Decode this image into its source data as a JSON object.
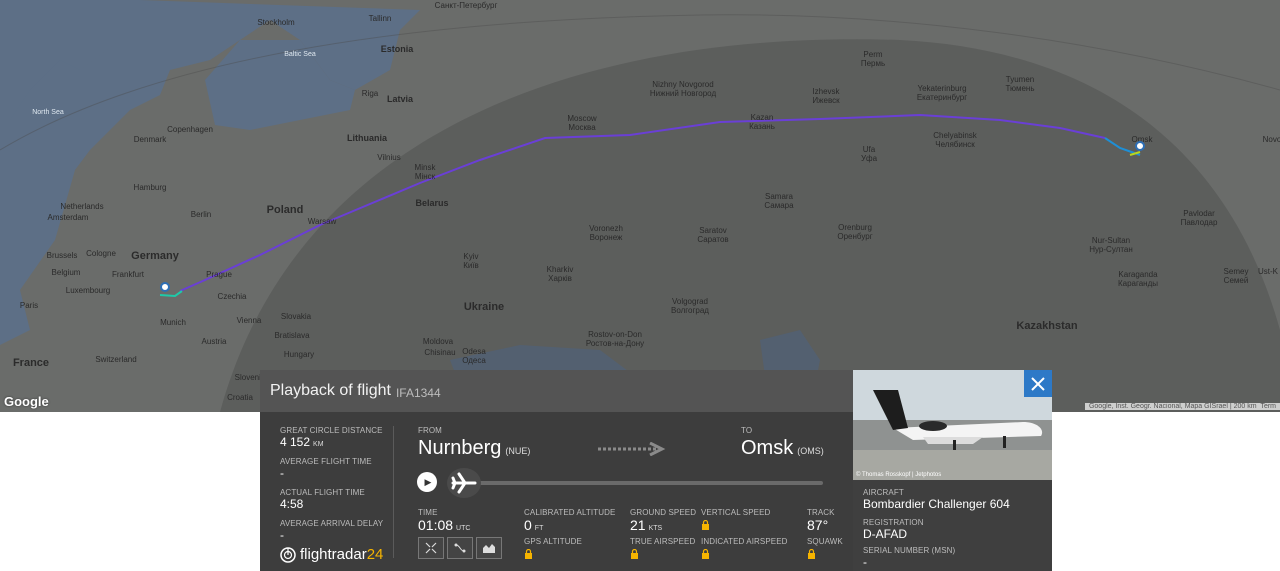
{
  "map": {
    "seas": [
      "Baltic Sea",
      "North Sea"
    ],
    "countries": [
      "Germany",
      "Poland",
      "Ukraine",
      "Belarus",
      "Latvia",
      "Lithuania",
      "Estonia",
      "France",
      "Kazakhstan",
      "Netherlands",
      "Belgium",
      "Luxembourg",
      "Czechia",
      "Slovakia",
      "Hungary",
      "Austria",
      "Switzerland",
      "Moldova",
      "Slovenia",
      "Croatia",
      "Denmark"
    ],
    "cities": [
      {
        "n": "Stockholm"
      },
      {
        "n": "Tallinn"
      },
      {
        "n": "Санкт-Петербург"
      },
      {
        "n": "Riga"
      },
      {
        "n": "Copenhagen"
      },
      {
        "n": "Hamburg"
      },
      {
        "n": "Amsterdam"
      },
      {
        "n": "Berlin"
      },
      {
        "n": "Brussels"
      },
      {
        "n": "Cologne"
      },
      {
        "n": "Frankfurt"
      },
      {
        "n": "Prague"
      },
      {
        "n": "Munich"
      },
      {
        "n": "Vienna"
      },
      {
        "n": "Bratislava"
      },
      {
        "n": "Warsaw"
      },
      {
        "n": "Vilnius"
      },
      {
        "n": "Minsk",
        "n2": "Мінск"
      },
      {
        "n": "Kyiv",
        "n2": "Київ"
      },
      {
        "n": "Kharkiv",
        "n2": "Харків"
      },
      {
        "n": "Odesa",
        "n2": "Одеса"
      },
      {
        "n": "Chisinau"
      },
      {
        "n": "Moscow",
        "n2": "Москва"
      },
      {
        "n": "Nizhny Novgorod",
        "n2": "Нижний Новгород"
      },
      {
        "n": "Kazan",
        "n2": "Казань"
      },
      {
        "n": "Izhevsk",
        "n2": "Ижевск"
      },
      {
        "n": "Perm",
        "n2": "Пермь"
      },
      {
        "n": "Yekaterinburg",
        "n2": "Екатеринбург"
      },
      {
        "n": "Chelyabinsk",
        "n2": "Челябинск"
      },
      {
        "n": "Tyumen",
        "n2": "Тюмень"
      },
      {
        "n": "Omsk"
      },
      {
        "n": "Ufa",
        "n2": "Уфа"
      },
      {
        "n": "Samara",
        "n2": "Самара"
      },
      {
        "n": "Voronezh",
        "n2": "Воронеж"
      },
      {
        "n": "Saratov",
        "n2": "Саратов"
      },
      {
        "n": "Orenburg",
        "n2": "Оренбург"
      },
      {
        "n": "Volgograd",
        "n2": "Волгоград"
      },
      {
        "n": "Rostov-on-Don",
        "n2": "Ростов-на-Дону"
      },
      {
        "n": "Nur-Sultan",
        "n2": "Нур-Султан"
      },
      {
        "n": "Karaganda",
        "n2": "Караганды"
      },
      {
        "n": "Pavlodar",
        "n2": "Павлодар"
      },
      {
        "n": "Semey",
        "n2": "Семей"
      },
      {
        "n": "Ust-K"
      },
      {
        "n": "Paris"
      },
      {
        "n": "Novo"
      }
    ],
    "google": "Google",
    "attribution": "Google, Inst. Geogr. Nacional, Mapa GISrael | 200 km",
    "attribution_tail": "Term"
  },
  "panel": {
    "title": "Playback of flight",
    "flight_id": "IFA1344",
    "great_circle_label": "GREAT CIRCLE DISTANCE",
    "great_circle_value": "4 152",
    "great_circle_unit": "KM",
    "avg_time_label": "AVERAGE FLIGHT TIME",
    "avg_time_value": "-",
    "actual_time_label": "ACTUAL FLIGHT TIME",
    "actual_time_value": "4:58",
    "avg_delay_label": "AVERAGE ARRIVAL DELAY",
    "avg_delay_value": "-",
    "from_label": "FROM",
    "from_city": "Nurnberg",
    "from_code": "(NUE)",
    "to_label": "TO",
    "to_city": "Omsk",
    "to_code": "(OMS)",
    "time_label": "TIME",
    "time_value": "01:08",
    "time_unit": "UTC",
    "cal_alt_label": "CALIBRATED ALTITUDE",
    "cal_alt_value": "0",
    "cal_alt_unit": "FT",
    "gps_alt_label": "GPS ALTITUDE",
    "ground_speed_label": "GROUND SPEED",
    "ground_speed_value": "21",
    "ground_speed_unit": "KTS",
    "true_airspeed_label": "TRUE AIRSPEED",
    "vertical_speed_label": "VERTICAL SPEED",
    "indicated_airspeed_label": "INDICATED AIRSPEED",
    "track_label": "TRACK",
    "track_value": "87°",
    "squawk_label": "SQUAWK",
    "logo_text": "flightradar",
    "logo_num": "24"
  },
  "aircraft": {
    "photo_credit": "© Thomas Rosskopf | Jetphotos",
    "aircraft_label": "AIRCRAFT",
    "aircraft_value": "Bombardier Challenger 604",
    "registration_label": "REGISTRATION",
    "registration_value": "D-AFAD",
    "serial_label": "SERIAL NUMBER (MSN)",
    "serial_value": "-"
  },
  "colors": {
    "route": "#6a3fd6",
    "accent": "#2d79c7",
    "brand_yellow": "#f6b400"
  }
}
